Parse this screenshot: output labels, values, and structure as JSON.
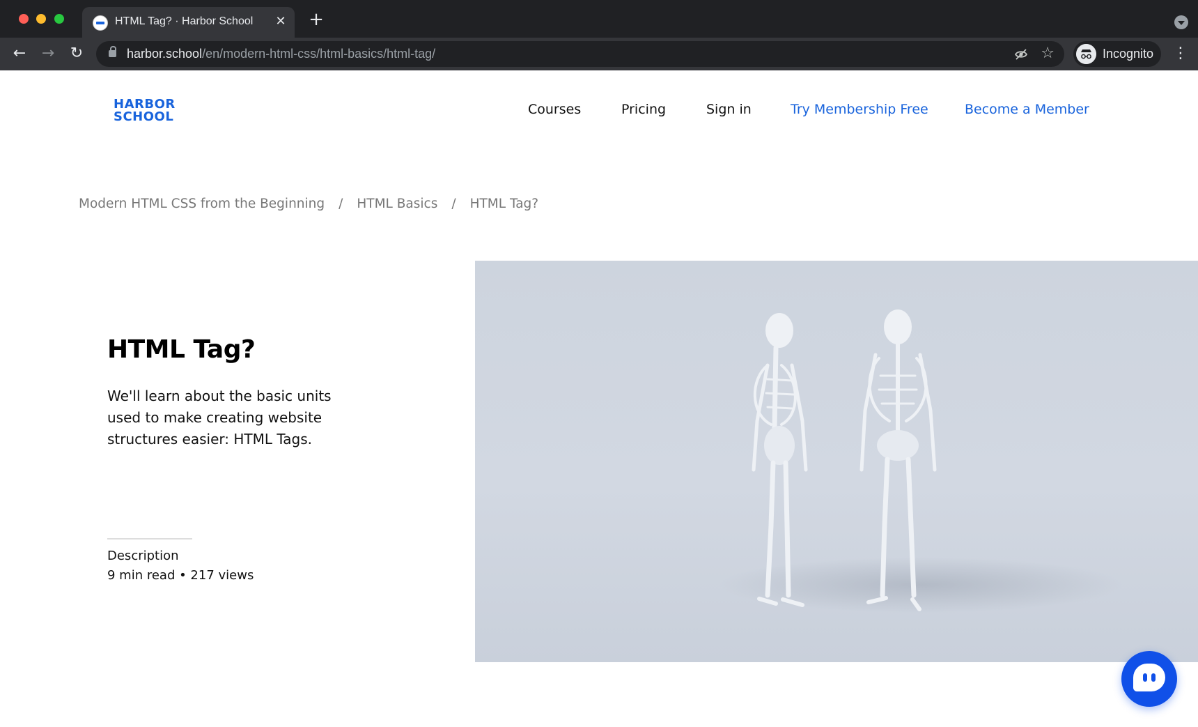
{
  "browser": {
    "tab_title": "HTML Tag? · Harbor School",
    "tab_close": "✕",
    "new_tab": "+",
    "url_host": "harbor.school",
    "url_path": "/en/modern-html-css/html-basics/html-tag/",
    "profile_label": "Incognito",
    "icons": [
      "back-icon",
      "forward-icon",
      "reload-icon",
      "lock-icon",
      "eye-off-icon",
      "star-icon",
      "incognito-icon",
      "menu-icon"
    ]
  },
  "site": {
    "logo_line1": "HARBOR",
    "logo_line2": "SCHOOL",
    "nav": {
      "courses": "Courses",
      "pricing": "Pricing",
      "sign_in": "Sign in",
      "try_free": "Try Membership Free",
      "become_member": "Become a Member"
    },
    "accent_color": "#1863dc"
  },
  "breadcrumb": {
    "items": [
      "Modern HTML CSS from the Beginning",
      "HTML Basics",
      "HTML Tag?"
    ],
    "separator": "/"
  },
  "lesson": {
    "title": "HTML Tag?",
    "description": "We'll learn about the basic units used to make creating website structures easier: HTML Tags.",
    "meta_label": "Description",
    "meta_value": "9 min read • 217 views"
  },
  "hero": {
    "icon": "skeletons-illustration"
  },
  "chat": {
    "icon": "chat-icon",
    "color": "#1050e8"
  }
}
